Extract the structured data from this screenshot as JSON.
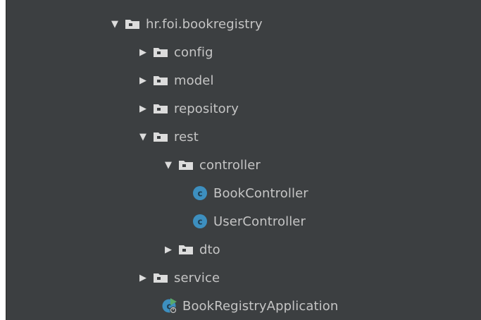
{
  "tree": {
    "root": {
      "label": "hr.foi.bookregistry",
      "expanded": true,
      "icon": "package-folder-icon"
    },
    "items": [
      {
        "label": "config",
        "expanded": false,
        "icon": "package-folder-icon"
      },
      {
        "label": "model",
        "expanded": false,
        "icon": "package-folder-icon"
      },
      {
        "label": "repository",
        "expanded": false,
        "icon": "package-folder-icon"
      },
      {
        "label": "rest",
        "expanded": true,
        "icon": "package-folder-icon"
      },
      {
        "label": "controller",
        "expanded": true,
        "icon": "package-folder-icon"
      },
      {
        "label": "BookController",
        "icon": "java-class-icon"
      },
      {
        "label": "UserController",
        "icon": "java-class-icon"
      },
      {
        "label": "dto",
        "expanded": false,
        "icon": "package-folder-icon"
      },
      {
        "label": "service",
        "expanded": false,
        "icon": "package-folder-icon"
      },
      {
        "label": "BookRegistryApplication",
        "icon": "spring-boot-app-icon"
      }
    ]
  },
  "glyphs": {
    "expanded": "▼",
    "collapsed": "▶"
  },
  "colors": {
    "panel_background": "#3c3f41",
    "text": "#c5c5c5",
    "folder": "#dcdcdc",
    "class_icon": "#3d8fbf"
  }
}
